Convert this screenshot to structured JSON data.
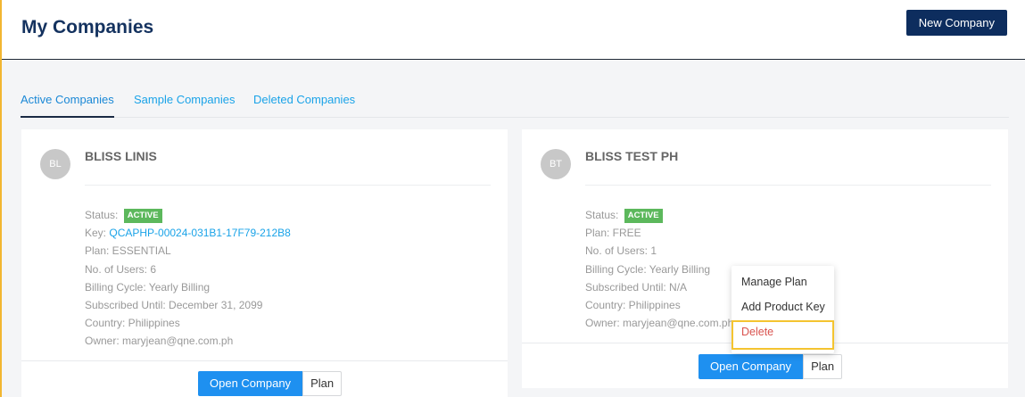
{
  "header": {
    "title": "My Companies",
    "new_company_label": "New Company"
  },
  "tabs": [
    {
      "label": "Active Companies",
      "active": true
    },
    {
      "label": "Sample Companies",
      "active": false
    },
    {
      "label": "Deleted Companies",
      "active": false
    }
  ],
  "cards": [
    {
      "initials": "BL",
      "name": "BLISS LINIS",
      "status_label": "Status:",
      "status_value": "ACTIVE",
      "key_label": "Key:",
      "key_value": "QCAPHP-00024-031B1-17F79-212B8",
      "plan": "Plan: ESSENTIAL",
      "users": "No. of Users: 6",
      "billing": "Billing Cycle: Yearly Billing",
      "subscribed": "Subscribed Until: December 31, 2099",
      "country": "Country: Philippines",
      "owner": "Owner: maryjean@qne.com.ph",
      "open_label": "Open Company",
      "plan_label": "Plan"
    },
    {
      "initials": "BT",
      "name": "BLISS TEST PH",
      "status_label": "Status:",
      "status_value": "ACTIVE",
      "plan": "Plan: FREE",
      "users": "No. of Users: 1",
      "billing": "Billing Cycle: Yearly Billing",
      "subscribed": "Subscribed Until: N/A",
      "country": "Country: Philippines",
      "owner": "Owner: maryjean@qne.com.ph",
      "open_label": "Open Company",
      "plan_label": "Plan"
    }
  ],
  "plan_menu": {
    "items": [
      "Manage Plan",
      "Add Product Key",
      "Delete"
    ]
  },
  "colors": {
    "accent": "#1e90f0",
    "navy": "#0d2d5e",
    "status_green": "#5cb85c",
    "delete_red": "#d9534f",
    "highlight": "#f4c430"
  }
}
